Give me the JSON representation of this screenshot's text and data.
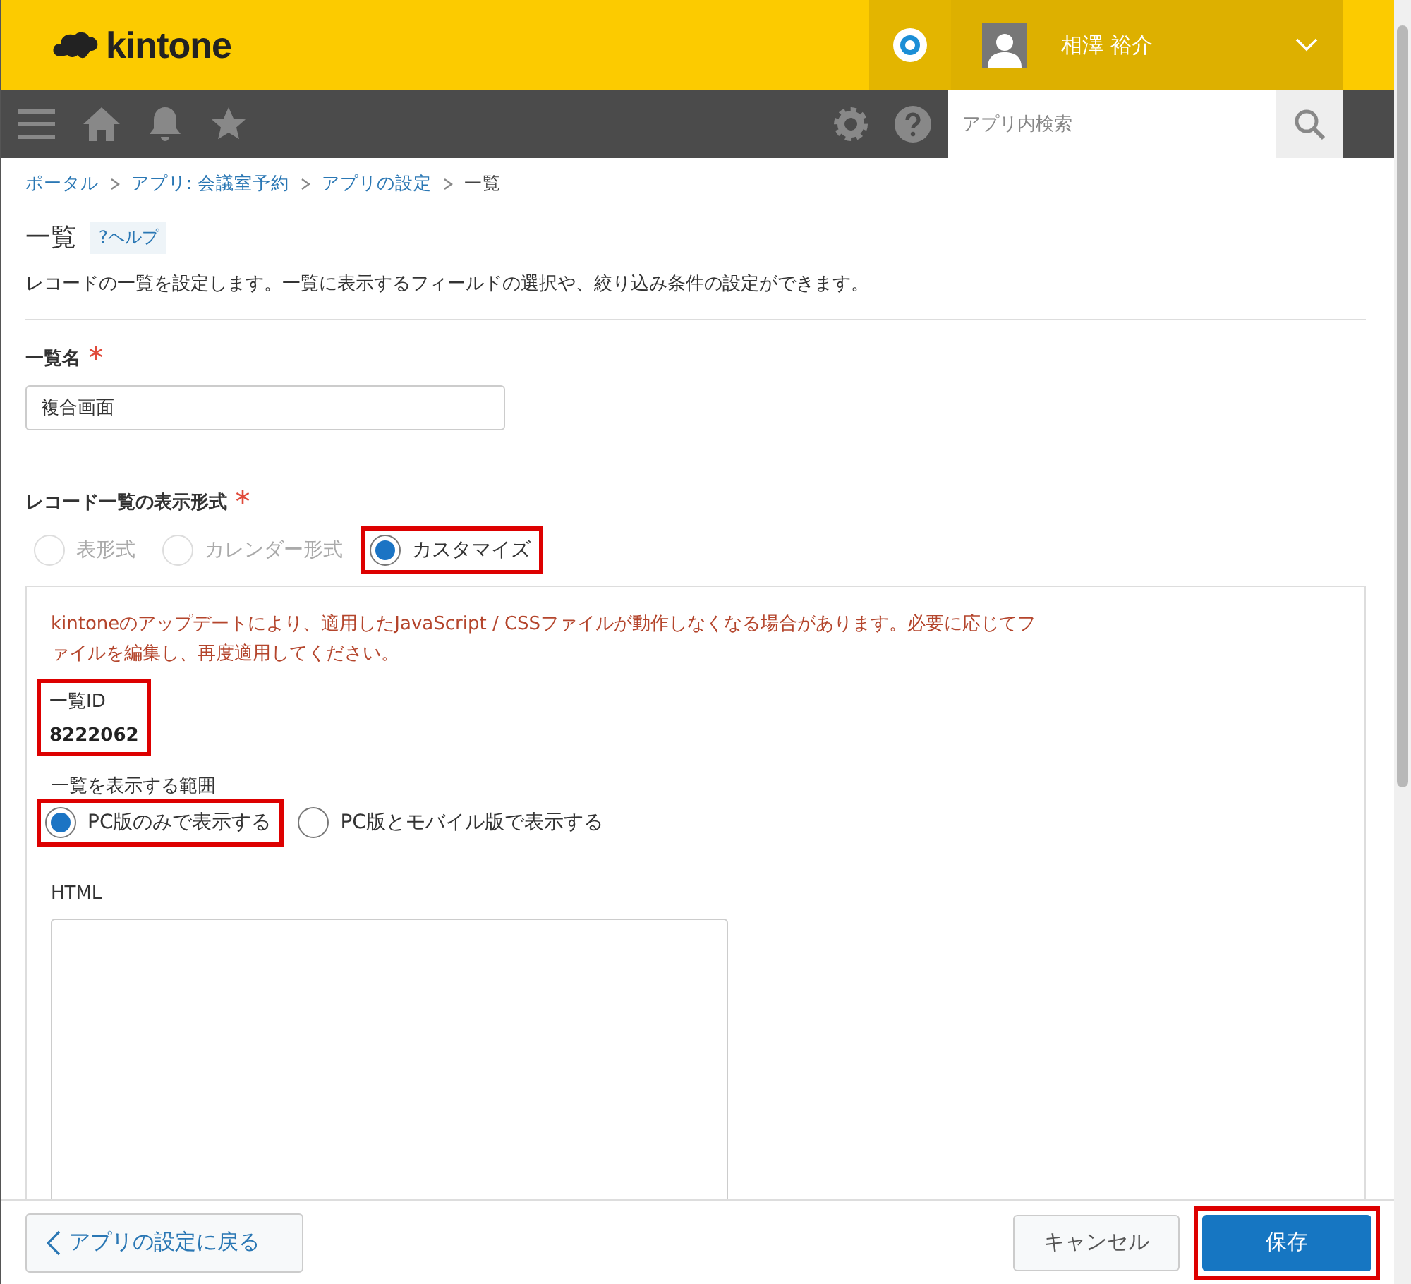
{
  "header": {
    "logo": "kintone",
    "user_name": "相澤 裕介"
  },
  "nav": {
    "search": {
      "placeholder": "アプリ内検索"
    }
  },
  "breadcrumbs": [
    {
      "label": "ポータル",
      "link": true
    },
    {
      "label": "アプリ: 会議室予約",
      "link": true
    },
    {
      "label": "アプリの設定",
      "link": true
    },
    {
      "label": "一覧",
      "link": false
    }
  ],
  "page": {
    "title": "一覧",
    "help": "?ヘルプ",
    "description": "レコードの一覧を設定します。一覧に表示するフィールドの選択や、絞り込み条件の設定ができます。"
  },
  "view_name": {
    "label": "一覧名",
    "required": true,
    "value": "複合画面"
  },
  "display_format": {
    "label": "レコード一覧の表示形式",
    "required": true,
    "options": [
      {
        "label": "表形式",
        "selected": false,
        "highlighted": false
      },
      {
        "label": "カレンダー形式",
        "selected": false,
        "highlighted": false
      },
      {
        "label": "カスタマイズ",
        "selected": true,
        "highlighted": true
      }
    ]
  },
  "custom_panel": {
    "warning": "kintoneのアップデートにより、適用したJavaScript / CSSファイルが動作しなくなる場合があります。必要に応じてファイルを編集し、再度適用してください。",
    "view_id": {
      "label": "一覧ID",
      "value": "8222062",
      "highlighted": true
    },
    "scope": {
      "label": "一覧を表示する範囲",
      "options": [
        {
          "label": "PC版のみで表示する",
          "selected": true,
          "highlighted": true
        },
        {
          "label": "PC版とモバイル版で表示する",
          "selected": false,
          "highlighted": false
        }
      ]
    },
    "html": {
      "label": "HTML"
    }
  },
  "footer": {
    "back": "アプリの設定に戻る",
    "cancel": "キャンセル",
    "save": {
      "label": "保存",
      "highlighted": true
    }
  }
}
